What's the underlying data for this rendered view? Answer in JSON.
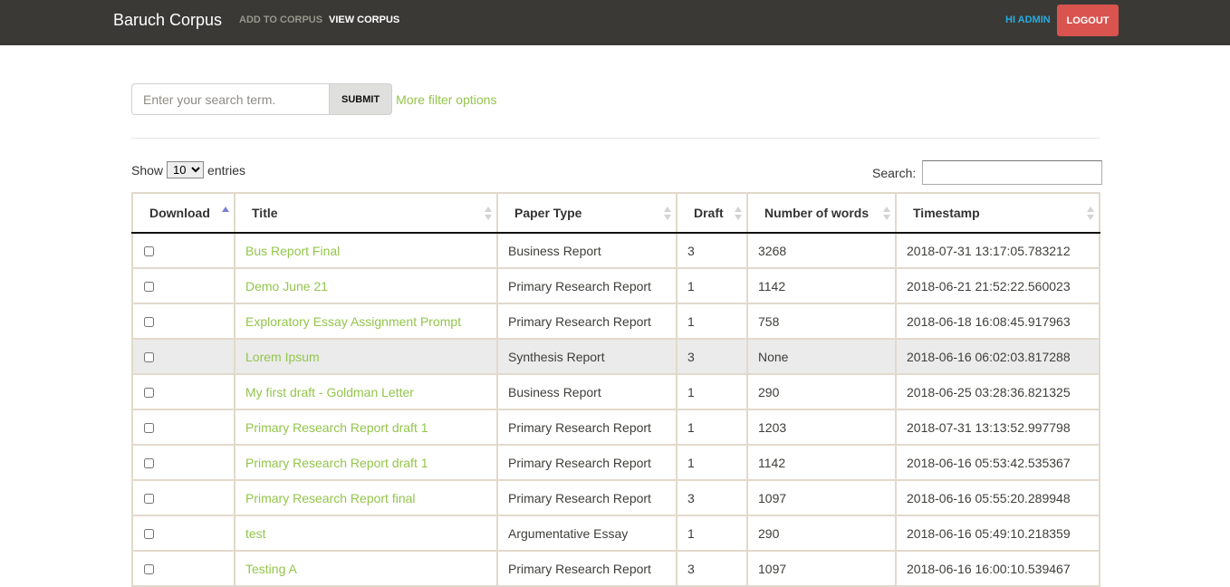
{
  "navbar": {
    "brand": "Baruch Corpus",
    "links": [
      "ADD TO CORPUS",
      "VIEW CORPUS"
    ],
    "greeting": "HI ADMIN",
    "logout_label": "LOGOUT"
  },
  "search": {
    "placeholder": "Enter your search term.",
    "value": "",
    "submit_label": "SUBMIT",
    "more_filters_label": "More filter options"
  },
  "table_controls": {
    "show_label": "Show",
    "entries_label": "entries",
    "page_size": "10",
    "search_label": "Search:",
    "search_value": ""
  },
  "table": {
    "columns": [
      "Download",
      "Title",
      "Paper Type",
      "Draft",
      "Number of words",
      "Timestamp"
    ],
    "sorted_column": "Download",
    "sort_direction": "ascending",
    "rows": [
      {
        "title": "Bus Report Final",
        "type": "Business Report",
        "draft": "3",
        "words": "3268",
        "timestamp": "2018-07-31 13:17:05.783212"
      },
      {
        "title": "Demo June 21",
        "type": "Primary Research Report",
        "draft": "1",
        "words": "1142",
        "timestamp": "2018-06-21 21:52:22.560023"
      },
      {
        "title": "Exploratory Essay Assignment Prompt",
        "type": "Primary Research Report",
        "draft": "1",
        "words": "758",
        "timestamp": "2018-06-18 16:08:45.917963"
      },
      {
        "title": "Lorem Ipsum",
        "type": "Synthesis Report",
        "draft": "3",
        "words": "None",
        "timestamp": "2018-06-16 06:02:03.817288"
      },
      {
        "title": "My first draft - Goldman Letter",
        "type": "Business Report",
        "draft": "1",
        "words": "290",
        "timestamp": "2018-06-25 03:28:36.821325"
      },
      {
        "title": "Primary Research Report draft 1",
        "type": "Primary Research Report",
        "draft": "1",
        "words": "1203",
        "timestamp": "2018-07-31 13:13:52.997798"
      },
      {
        "title": "Primary Research Report draft 1",
        "type": "Primary Research Report",
        "draft": "1",
        "words": "1142",
        "timestamp": "2018-06-16 05:53:42.535367"
      },
      {
        "title": "Primary Research Report final",
        "type": "Primary Research Report",
        "draft": "3",
        "words": "1097",
        "timestamp": "2018-06-16 05:55:20.289948"
      },
      {
        "title": "test",
        "type": "Argumentative Essay",
        "draft": "1",
        "words": "290",
        "timestamp": "2018-06-16 05:49:10.218359"
      },
      {
        "title": "Testing A",
        "type": "Primary Research Report",
        "draft": "3",
        "words": "1097",
        "timestamp": "2018-06-16 16:00:10.539467"
      }
    ],
    "hovered_row": 3
  },
  "colors": {
    "navbar_bg": "#3a3935",
    "accent_green": "#93c54b",
    "logout_red": "#d9534f",
    "greeting_blue": "#29abe0",
    "table_border": "#e2d9cc",
    "hover_row": "#ebebeb"
  }
}
